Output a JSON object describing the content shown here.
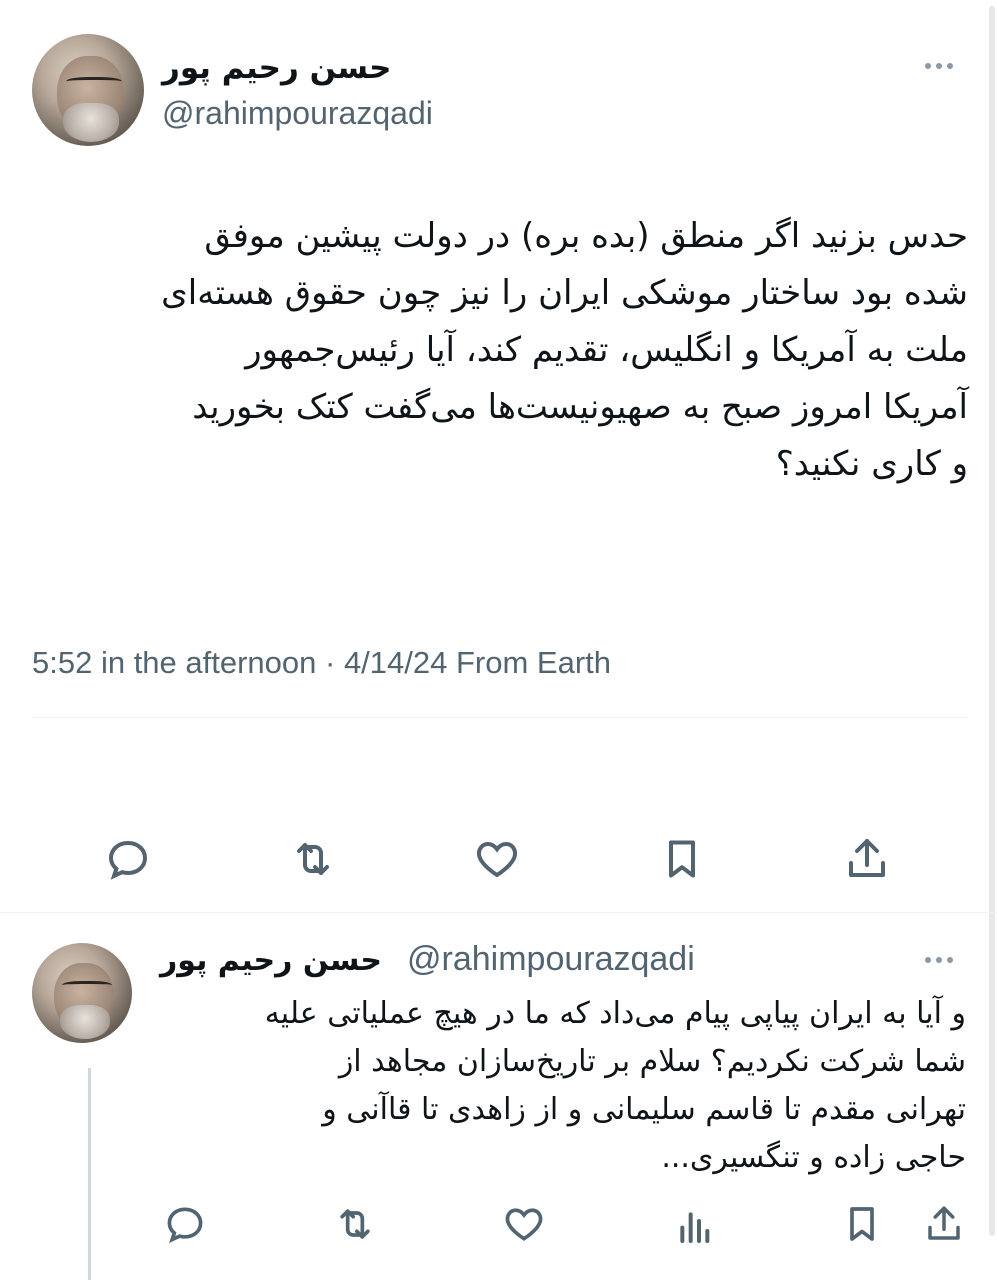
{
  "main_tweet": {
    "display_name": "حسن رحیم پور",
    "handle": "@rahimpourazqadi",
    "body_lines": [
      "حدس بزنید اگر منطق (بده بره) در دولت پیشین موفق",
      "شده بود ساختار موشکی ایران را نیز چون حقوق هسته‌ای",
      "ملت به آمریکا و انگلیس، تقدیم کند، آیا رئیس‌جمهور",
      "آمریکا امروز صبح به صهیونیست‌ها می‌گفت کتک بخورید",
      "و کاری نکنید؟"
    ],
    "timestamp": "5:52 in the afternoon · 4/14/24 From Earth",
    "actions": {
      "reply_icon": "reply-icon",
      "retweet_icon": "retweet-icon",
      "like_icon": "heart-icon",
      "bookmark_icon": "bookmark-icon",
      "share_icon": "share-icon"
    }
  },
  "reply_tweet": {
    "display_name": "حسن رحیم پور",
    "handle": "@rahimpourazqadi",
    "body_lines": [
      "و آیا به ایران پیاپی پیام می‌داد که ما در هیچ عملیاتی علیه",
      "شما شرکت نکردیم؟ سلام بر تاریخ‌سازان مجاهد از",
      "تهرانی مقدم تا قاسم سلیمانی و از زاهدی تا قاآنی و",
      "حاجی زاده و تنگسیری..."
    ],
    "actions": {
      "reply_icon": "reply-icon",
      "retweet_icon": "retweet-icon",
      "like_icon": "heart-icon",
      "views_icon": "views-icon",
      "bookmark_icon": "bookmark-icon",
      "share_icon": "share-icon"
    }
  },
  "colors": {
    "text_primary": "#0f1419",
    "text_secondary": "#536471",
    "divider": "#eff3f4",
    "icon": "#536471"
  }
}
